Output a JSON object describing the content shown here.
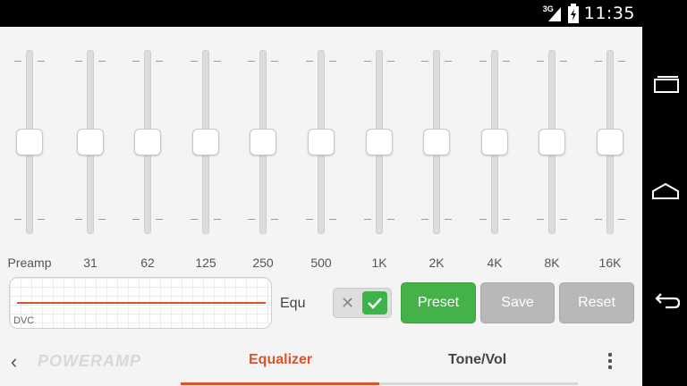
{
  "status_bar": {
    "network": "3G",
    "time": "11:35",
    "icons": [
      "signal-icon",
      "battery-icon"
    ]
  },
  "equalizer": {
    "bands": [
      {
        "label": "Preamp",
        "level": 0
      },
      {
        "label": "31",
        "level": 0
      },
      {
        "label": "62",
        "level": 0
      },
      {
        "label": "125",
        "level": 0
      },
      {
        "label": "250",
        "level": 0
      },
      {
        "label": "500",
        "level": 0
      },
      {
        "label": "1K",
        "level": 0
      },
      {
        "label": "2K",
        "level": 0
      },
      {
        "label": "4K",
        "level": 0
      },
      {
        "label": "8K",
        "level": 0
      },
      {
        "label": "16K",
        "level": 0
      }
    ]
  },
  "dvc": {
    "label": "DVC"
  },
  "equ": {
    "label": "Equ",
    "enabled": true
  },
  "buttons": {
    "preset": "Preset",
    "save": "Save",
    "reset": "Reset"
  },
  "tabs": {
    "logo": "POWERAMP",
    "items": [
      {
        "label": "Equalizer",
        "active": true
      },
      {
        "label": "Tone/Vol",
        "active": false
      }
    ]
  },
  "colors": {
    "accent": "#d9532b",
    "preset_green": "#45b249",
    "disabled_gray": "#b8b8b8"
  },
  "nav_bar": {
    "icons": [
      "recent-apps-icon",
      "home-icon",
      "back-icon"
    ]
  }
}
